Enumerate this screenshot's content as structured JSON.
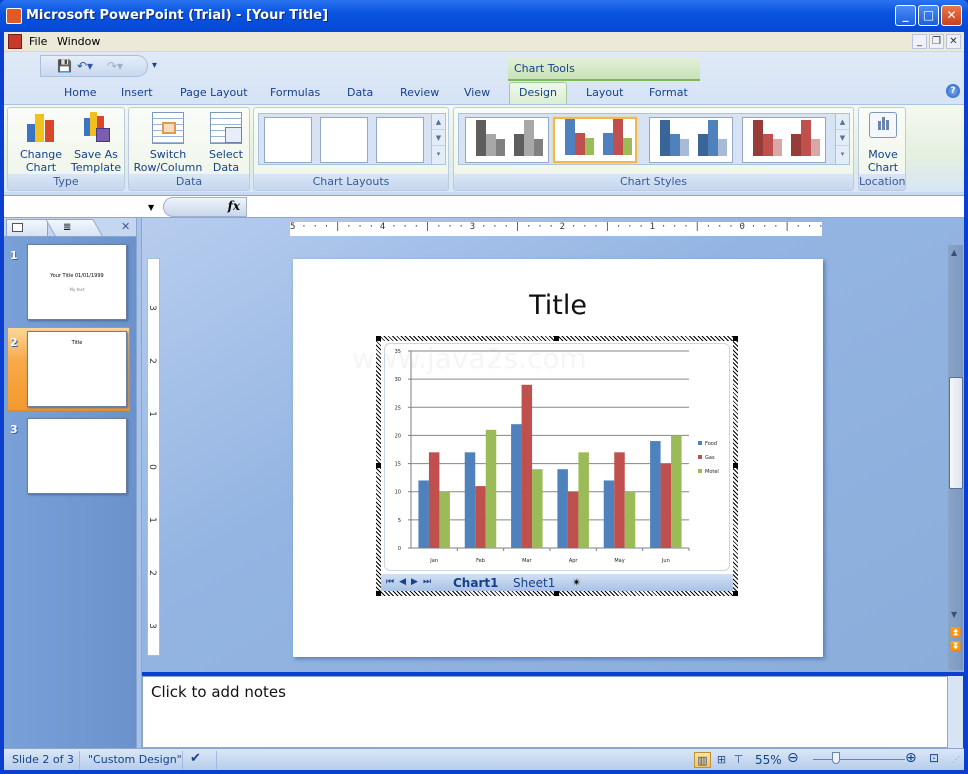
{
  "window": {
    "title": "Microsoft PowerPoint (Trial) - [Your Title]"
  },
  "menubar": {
    "items": [
      "File",
      "Window"
    ]
  },
  "ribbon": {
    "contextual_group": "Chart Tools",
    "tabs": [
      "Home",
      "Insert",
      "Page Layout",
      "Formulas",
      "Data",
      "Review",
      "View",
      "Design",
      "Layout",
      "Format"
    ],
    "active_tab": "Design",
    "groups": {
      "type": {
        "label": "Type",
        "buttons": [
          {
            "line1": "Change",
            "line2": "Chart Type"
          },
          {
            "line1": "Save As",
            "line2": "Template"
          }
        ]
      },
      "data": {
        "label": "Data",
        "buttons": [
          {
            "line1": "Switch",
            "line2": "Row/Column"
          },
          {
            "line1": "Select",
            "line2": "Data"
          }
        ]
      },
      "layouts": {
        "label": "Chart Layouts"
      },
      "styles": {
        "label": "Chart Styles",
        "selected_index": 1
      },
      "location": {
        "label": "Location",
        "buttons": [
          {
            "line1": "Move",
            "line2": "Chart"
          }
        ]
      }
    }
  },
  "formula_bar": {
    "fx_label": "fx",
    "name_box": "",
    "value": ""
  },
  "slides_pane": {
    "slides": [
      {
        "number": "1",
        "title": "Your Title 01/01/1999",
        "subtitle": "My text"
      },
      {
        "number": "2",
        "title": "Title"
      },
      {
        "number": "3",
        "title": ""
      }
    ],
    "selected": 2
  },
  "ruler": {
    "horizontal": "5 · · · | · · · 4 · · · | · · · 3 · · · | · · · 2 · · · | · · · 1 · · · | · · · 0 · · · | · · · 1 · · · | · · · 2 · · · | · · · 3 · · · | · · · 4 · · · | · · ·",
    "vertical_labels": [
      "3",
      "2",
      "1",
      "0",
      "1",
      "2",
      "3"
    ]
  },
  "slide": {
    "title": "Title",
    "watermark": "www.java2s.com",
    "sheet_tabs": [
      "Chart1",
      "Sheet1"
    ]
  },
  "chart_data": {
    "type": "bar",
    "title": "",
    "xlabel": "",
    "ylabel": "",
    "categories": [
      "Jan",
      "Feb",
      "Mar",
      "Apr",
      "May",
      "Jun"
    ],
    "series": [
      {
        "name": "Food",
        "color": "#4f81bd",
        "values": [
          12,
          17,
          22,
          14,
          12,
          19
        ]
      },
      {
        "name": "Gas",
        "color": "#c0504d",
        "values": [
          17,
          11,
          29,
          10,
          17,
          15
        ]
      },
      {
        "name": "Motel",
        "color": "#9bbb59",
        "values": [
          10,
          21,
          14,
          17,
          10,
          20
        ]
      }
    ],
    "ylim": [
      0,
      35
    ],
    "yticks": [
      0,
      5,
      10,
      15,
      20,
      25,
      30,
      35
    ],
    "grid": true,
    "legend": "right"
  },
  "notes": {
    "placeholder": "Click to add notes"
  },
  "status": {
    "slide": "Slide 2 of 3",
    "theme": "\"Custom Design\"",
    "zoom": "55%",
    "zoom_fraction": 0.55
  }
}
